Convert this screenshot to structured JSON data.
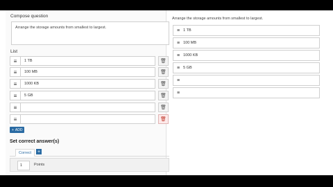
{
  "editor": {
    "compose_label": "Compose question",
    "question_text": "Arrange the storage amounts from smallest to largest.",
    "list_label": "List",
    "list_items": [
      "1 TB",
      "100 MB",
      "1000 KB",
      "5 GB",
      "",
      ""
    ],
    "add_label": "ADD",
    "set_answers_title": "Set correct answer(s)",
    "tab_correct": "Correct",
    "points_value": "1",
    "points_label": "Points"
  },
  "preview": {
    "question": "Arrange the storage amounts from smallest to largest.",
    "items": [
      "1 TB",
      "100 MB",
      "1000 KB",
      "5 GB",
      "",
      ""
    ]
  },
  "icons": {
    "handle": "≡",
    "trash": "🗑",
    "plus": "+"
  }
}
